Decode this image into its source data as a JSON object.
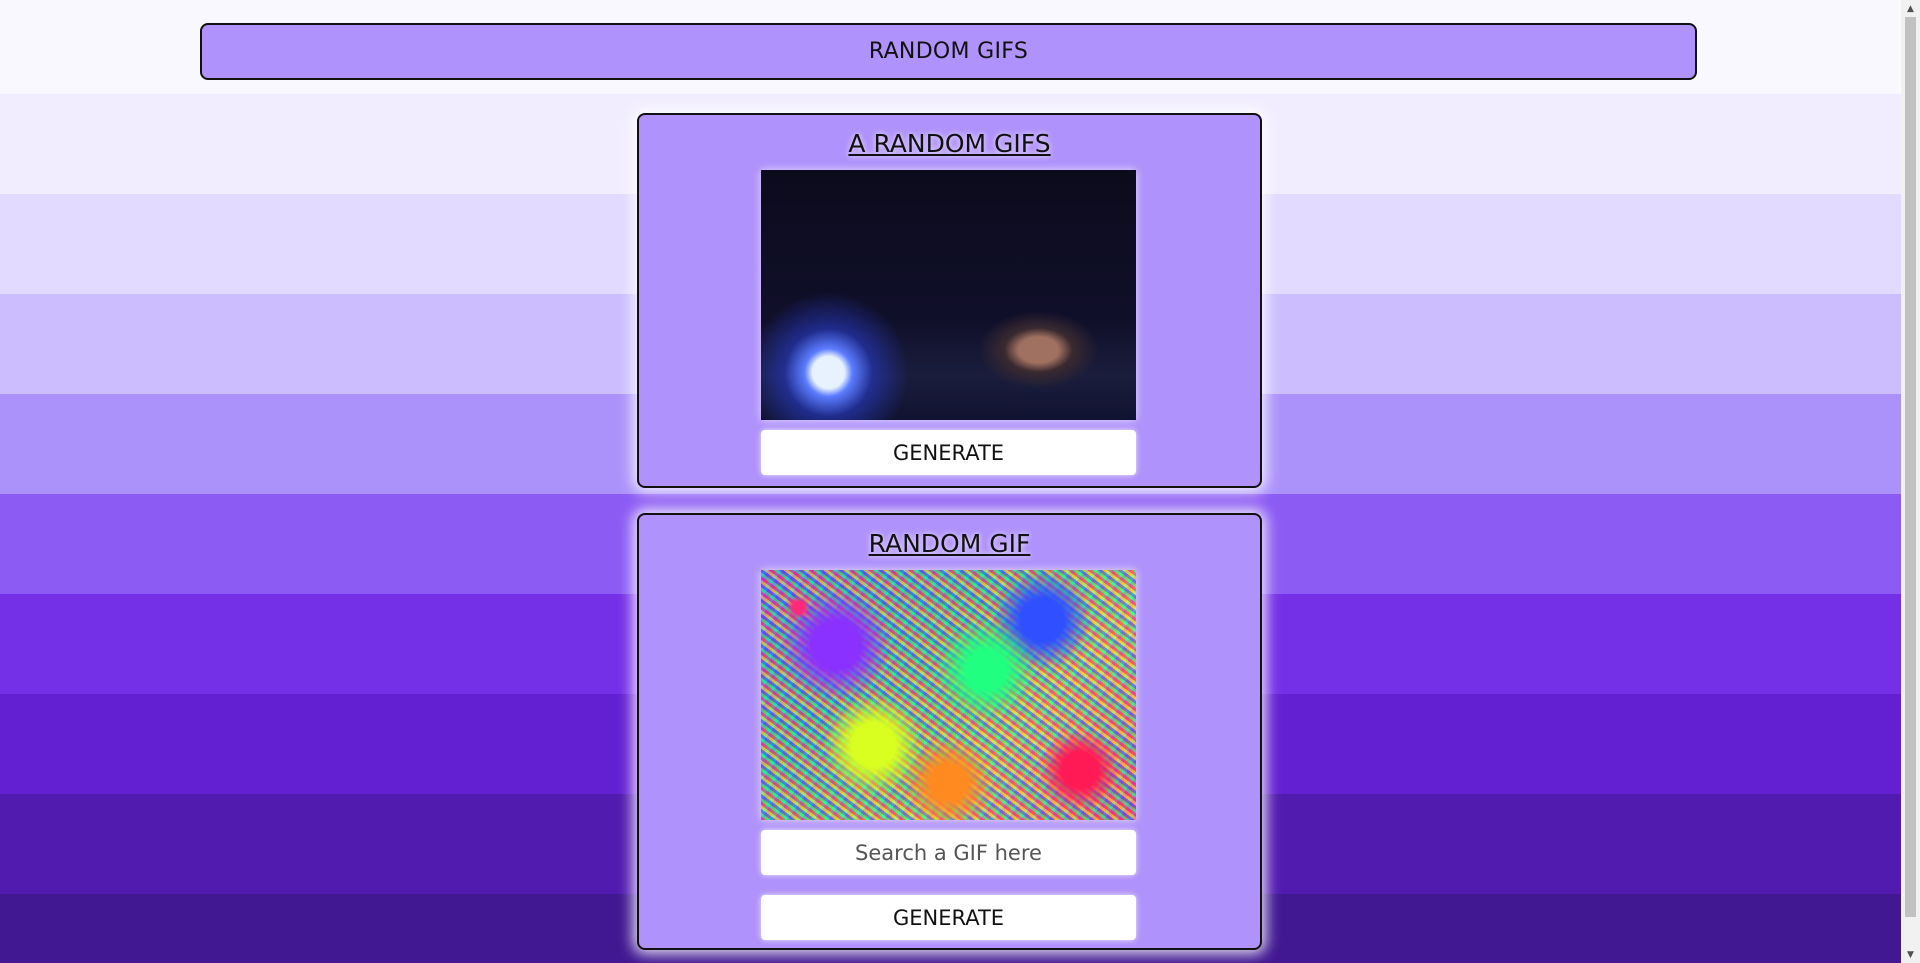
{
  "header": {
    "title": "RANDOM GIFS"
  },
  "random_card": {
    "title": "A RANDOM GIFS",
    "gif_alt": "Concert performer singing into microphone under blue stage light",
    "generate_label": "GENERATE"
  },
  "tag_card": {
    "title": "RANDOM GIF",
    "gif_alt": "Colorful psychedelic noise pattern",
    "search_placeholder": "Search a GIF here",
    "search_value": "",
    "generate_label": "GENERATE"
  },
  "colors": {
    "card_bg": "#af92fb",
    "stripe_top": "#faf8ff",
    "stripe_bottom": "#411892"
  }
}
